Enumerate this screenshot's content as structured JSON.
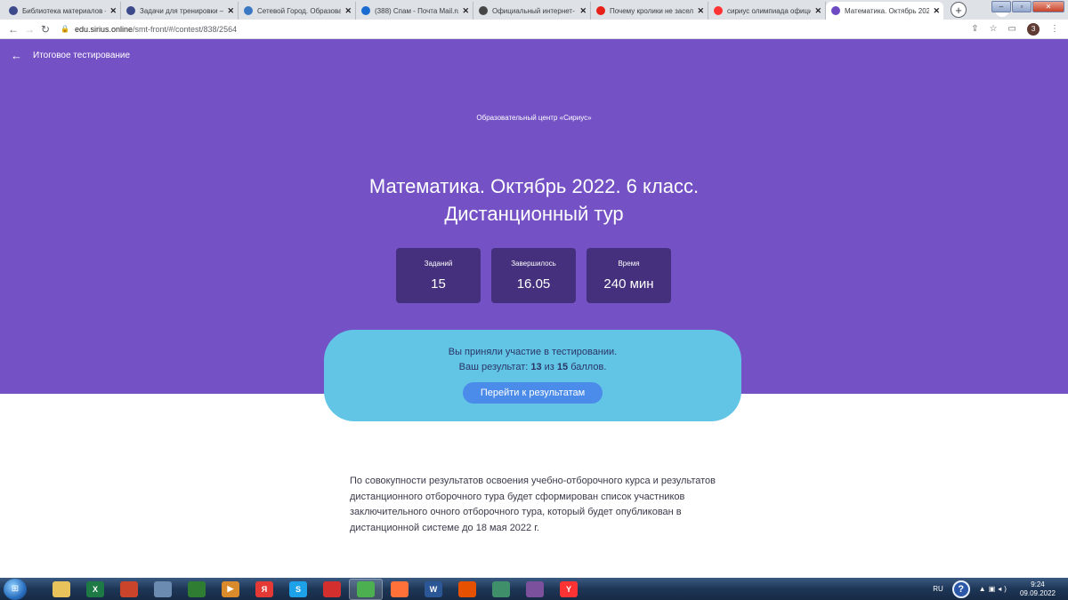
{
  "browser": {
    "tabs": [
      {
        "title": "Библиотека материалов –",
        "icon": "sirius-logo-icon",
        "color": "#3c4a8c"
      },
      {
        "title": "Задачи для тренировки – ",
        "icon": "sirius-logo-icon",
        "color": "#3c4a8c"
      },
      {
        "title": "Сетевой Город. Образова",
        "icon": "netcity-icon",
        "color": "#3b78c4"
      },
      {
        "title": "(388) Спам - Почта Mail.ru",
        "icon": "mail-icon",
        "color": "#1a6bd1"
      },
      {
        "title": "Официальный интернет-",
        "icon": "wordpress-icon",
        "color": "#464646"
      },
      {
        "title": "Почему кролики не засел",
        "icon": "youtube-icon",
        "color": "#e62117"
      },
      {
        "title": "сириус олимпиада офици",
        "icon": "yandex-icon",
        "color": "#f33"
      },
      {
        "title": "Математика. Октябрь 202",
        "icon": "sirius-shield-icon",
        "color": "#6d4ac2",
        "active": true
      }
    ],
    "new_tab": "+",
    "url_host": "edu.sirius.online",
    "url_path": "/smt-front/#/contest/838/2564",
    "profile_initial": "З"
  },
  "page": {
    "back_label": "Итоговое тестирование",
    "org": "Образовательный центр «Сириус»",
    "title_line1": "Математика. Октябрь 2022. 6 класс.",
    "title_line2": "Дистанционный тур",
    "stats": [
      {
        "label": "Заданий",
        "value": "15"
      },
      {
        "label": "Завершилось",
        "value": "16.05"
      },
      {
        "label": "Время",
        "value": "240 мин"
      }
    ],
    "result": {
      "line1": "Вы приняли участие в тестировании.",
      "line2_prefix": "Ваш результат: ",
      "score": "13",
      "line2_mid": " из ",
      "max": "15",
      "line2_suffix": " баллов.",
      "button": "Перейти к результатам"
    },
    "description": "По совокупности результатов освоения учебно-отборочного курса и результатов дистанционного отборочного тура будет сформирован список участников заключительного очного отборочного тура, который будет опубликован в дистанционной системе до 18 мая 2022 г."
  },
  "taskbar": {
    "apps": [
      {
        "icon": "file-explorer-icon",
        "color": "#e8c25a",
        "glyph": ""
      },
      {
        "icon": "excel-icon",
        "color": "#1d7a45",
        "glyph": "X"
      },
      {
        "icon": "presentation-icon",
        "color": "#c9442a",
        "glyph": ""
      },
      {
        "icon": "window-app-icon",
        "color": "#6b8bb0",
        "glyph": ""
      },
      {
        "icon": "eye-app-icon",
        "color": "#2f7d32",
        "glyph": ""
      },
      {
        "icon": "media-player-icon",
        "color": "#d98a2b",
        "glyph": "▶"
      },
      {
        "icon": "yandex-browser-icon",
        "color": "#e53935",
        "glyph": "Я"
      },
      {
        "icon": "skype-icon",
        "color": "#1da1e8",
        "glyph": "S"
      },
      {
        "icon": "pdf-icon",
        "color": "#d32f2f",
        "glyph": ""
      },
      {
        "icon": "chrome-icon",
        "color": "#4caf50",
        "glyph": "",
        "active": true
      },
      {
        "icon": "firefox-icon",
        "color": "#ff7139",
        "glyph": ""
      },
      {
        "icon": "word-icon",
        "color": "#2b5797",
        "glyph": "W"
      },
      {
        "icon": "film-icon",
        "color": "#e65100",
        "glyph": ""
      },
      {
        "icon": "image-viewer-icon",
        "color": "#3f8f6a",
        "glyph": ""
      },
      {
        "icon": "viber-icon",
        "color": "#7b519d",
        "glyph": ""
      },
      {
        "icon": "yandex-icon",
        "color": "#f33",
        "glyph": "Y"
      }
    ],
    "lang": "RU",
    "time": "9:24",
    "date": "09.09.2022"
  }
}
